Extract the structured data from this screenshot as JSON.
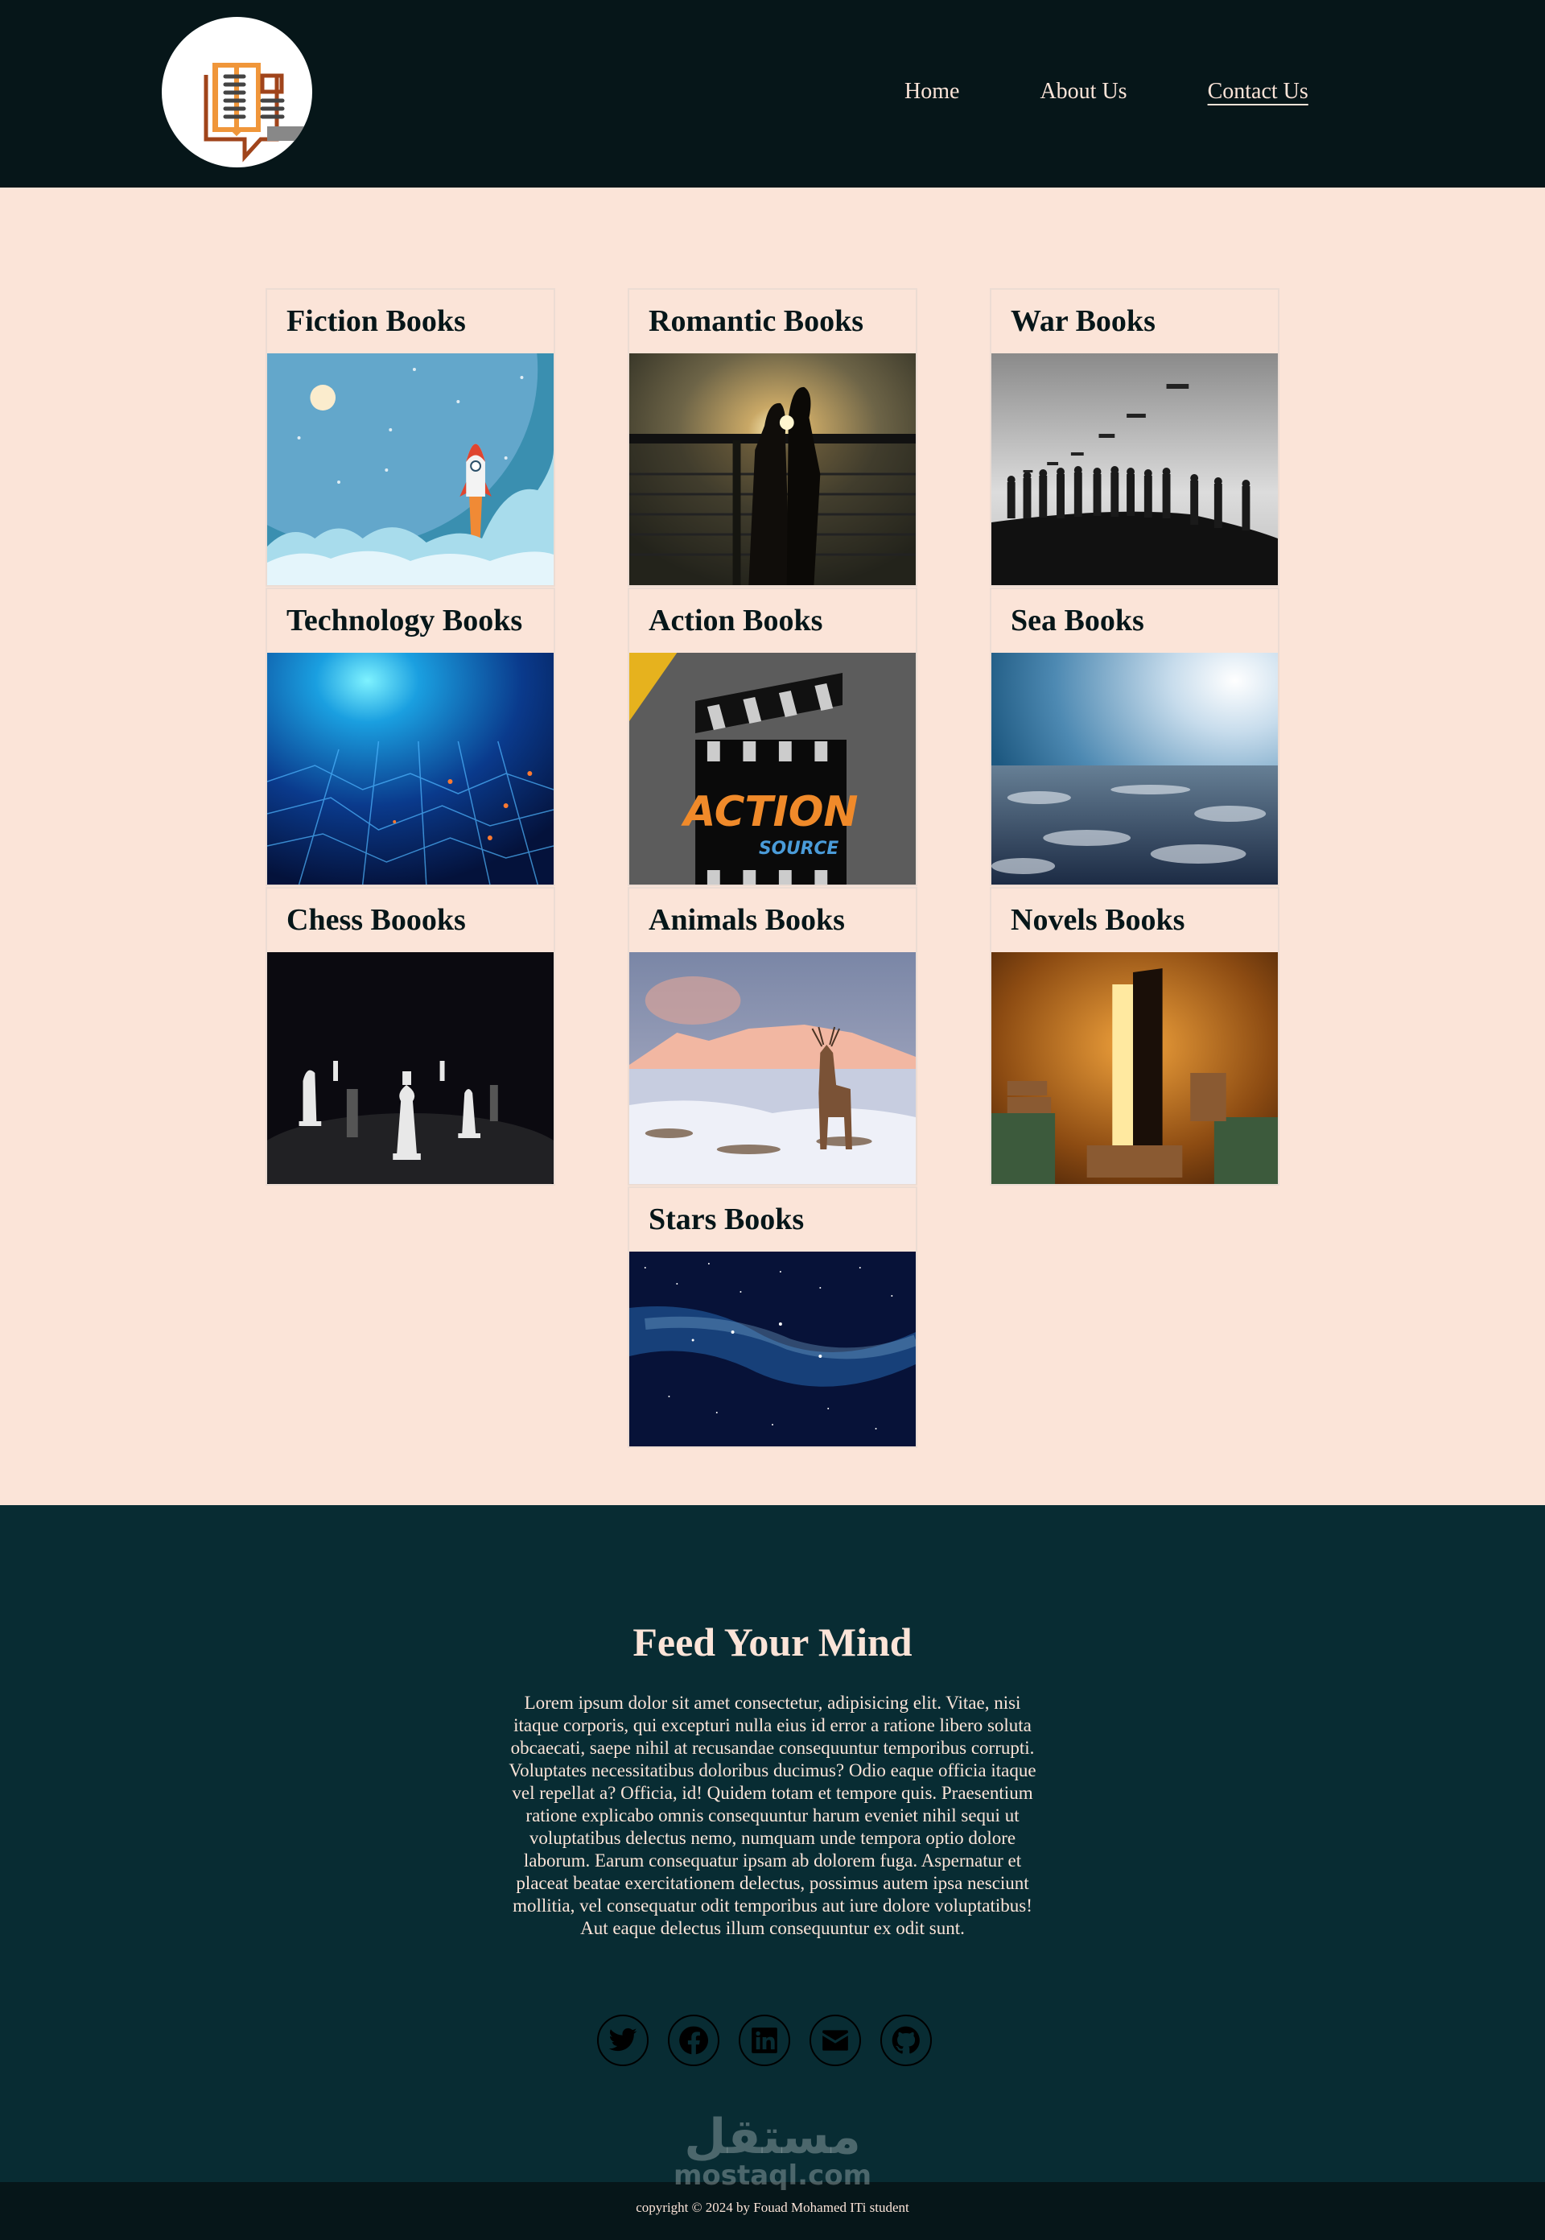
{
  "header": {
    "logo_alt": "open book speech bubble logo",
    "nav": [
      {
        "label": "Home",
        "active": false
      },
      {
        "label": "About Us",
        "active": false
      },
      {
        "label": "Contact Us",
        "active": true
      }
    ]
  },
  "categories": [
    {
      "title": "Fiction Books",
      "image": "rocket launching above clouds under night sky"
    },
    {
      "title": "Romantic Books",
      "image": "couple silhouette kissing at sunset by railing"
    },
    {
      "title": "War Books",
      "image": "soldiers silhouettes marching with drones overhead"
    },
    {
      "title": "Technology Books",
      "image": "blue glowing circuit board city"
    },
    {
      "title": "Action Books",
      "image": "film clapperboard with ACTION SOURCE text"
    },
    {
      "title": "Sea Books",
      "image": "stormy ocean waves under bright sky"
    },
    {
      "title": "Chess Boooks",
      "image": "chess pieces on dark board"
    },
    {
      "title": "Animals Books",
      "image": "red deer stag in snowy mountains"
    },
    {
      "title": "Novels Books",
      "image": "glowing open book door among stacked books"
    },
    {
      "title": "Stars Books",
      "image": "milky way starry night sky"
    }
  ],
  "footer": {
    "heading": "Feed Your Mind",
    "blurb": "Lorem ipsum dolor sit amet consectetur, adipisicing elit. Vitae, nisi itaque corporis, qui excepturi nulla eius id error a ratione libero soluta obcaecati, saepe nihil at recusandae consequuntur temporibus corrupti. Voluptates necessitatibus doloribus ducimus? Odio eaque officia itaque vel repellat a? Officia, id! Quidem totam et tempore quis. Praesentium ratione explicabo omnis consequuntur harum eveniet nihil sequi ut voluptatibus delectus nemo, numquam unde tempora optio dolore laborum. Earum consequatur ipsam ab dolorem fuga. Aspernatur et placeat beatae exercitationem delectus, possimus autem ipsa nesciunt mollitia, vel consequatur odit temporibus aut iure dolore voluptatibus! Aut eaque delectus illum consequuntur ex odit sunt.",
    "socials": [
      {
        "name": "twitter",
        "icon": "twitter-icon"
      },
      {
        "name": "facebook",
        "icon": "facebook-icon"
      },
      {
        "name": "linkedin",
        "icon": "linkedin-icon"
      },
      {
        "name": "email",
        "icon": "envelope-icon"
      },
      {
        "name": "github",
        "icon": "github-icon"
      }
    ],
    "watermark_arabic": "مستقل",
    "watermark_latin": "mostaql.com",
    "copyright": "copyright © 2024 by Fouad Mohamed ITi student"
  },
  "colors": {
    "header_bg": "#061619",
    "main_bg": "#fbe4d8",
    "footer_bg": "#082c33",
    "text_light": "#fbe4d8",
    "logo_orange": "#f0963a",
    "logo_brown": "#a0441b"
  }
}
